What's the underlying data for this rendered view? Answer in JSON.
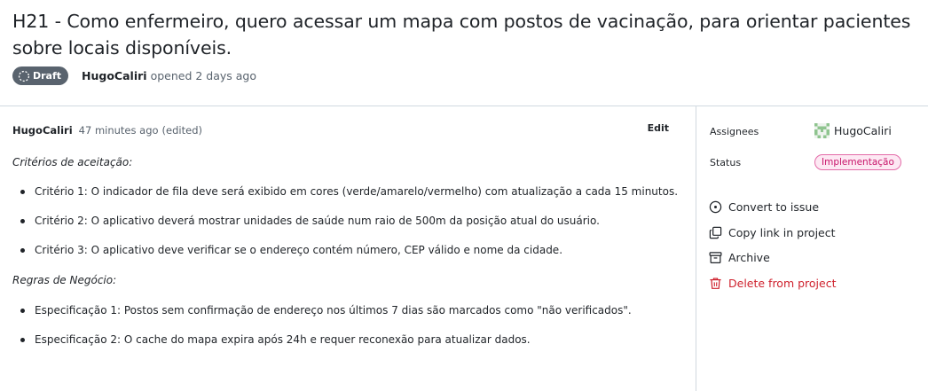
{
  "header": {
    "title": "H21 - Como enfermeiro, quero acessar um mapa com postos de vacinação, para orientar pacientes sobre locais disponíveis.",
    "badge": "Draft",
    "author": "HugoCaliri",
    "opened": "opened 2 days ago"
  },
  "comment": {
    "author": "HugoCaliri",
    "time": "47 minutes ago",
    "edited": "(edited)",
    "edit_label": "Edit",
    "sections": [
      {
        "title": "Critérios de aceitação:",
        "items": [
          "Critério 1: O indicador de fila deve será exibido em cores (verde/amarelo/vermelho) com atualização a cada 15 minutos.",
          "Critério 2: O aplicativo deverá mostrar unidades de saúde num raio de 500m da posição atual do usuário.",
          "Critério 3: O aplicativo deve verificar se o endereço contém número, CEP válido e nome da cidade."
        ]
      },
      {
        "title": "Regras de Negócio:",
        "items": [
          "Especificação 1: Postos sem confirmação de endereço nos últimos 7 dias são marcados como \"não verificados\".",
          "Especificação 2: O cache do mapa expira após 24h e requer reconexão para atualizar dados."
        ]
      }
    ]
  },
  "sidebar": {
    "assignees_label": "Assignees",
    "assignee": "HugoCaliri",
    "status_label": "Status",
    "status_value": "Implementação",
    "actions": {
      "convert": "Convert to issue",
      "copy": "Copy link in project",
      "archive": "Archive",
      "delete": "Delete from project"
    }
  },
  "colors": {
    "status_border": "#e36ba8",
    "status_text": "#c8166b",
    "danger": "#cf222e",
    "badge_bg": "#59636e"
  }
}
